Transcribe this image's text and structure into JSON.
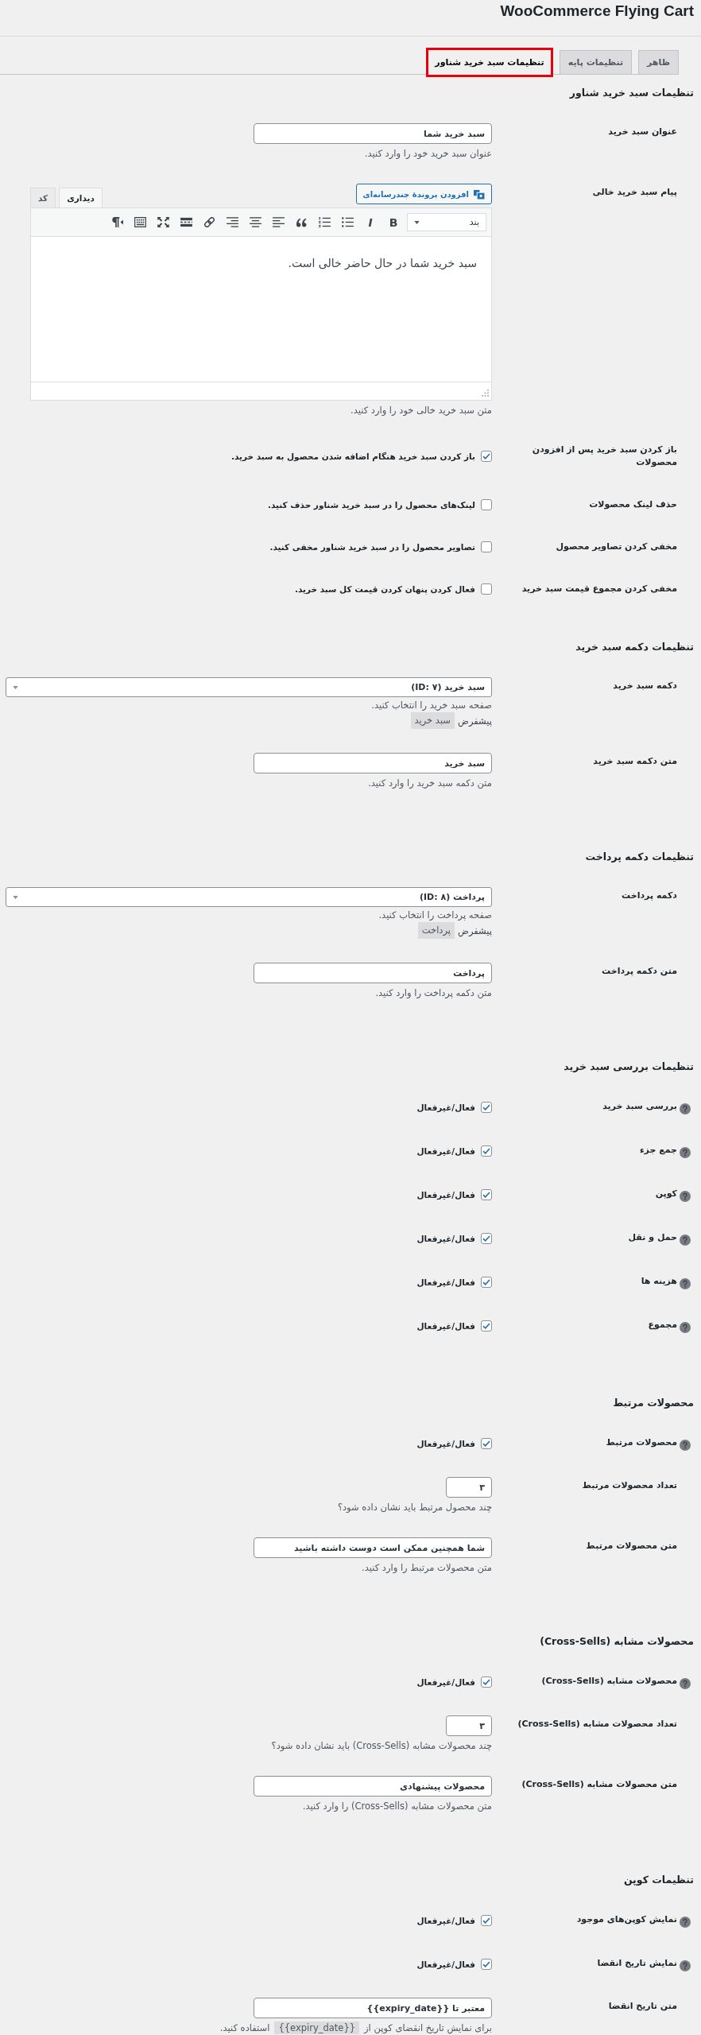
{
  "page_title": "WooCommerce Flying Cart",
  "tabs": [
    {
      "label": "ظاهر",
      "selected": false,
      "highlighted": false
    },
    {
      "label": "تنظیمات پایه",
      "selected": false,
      "highlighted": false
    },
    {
      "label": "تنظیمات سبد خرید شناور",
      "selected": true,
      "highlighted": true
    }
  ],
  "sections": [
    {
      "title": "تنظیمات سبد خرید شناور",
      "rows": [
        {
          "kind": "text",
          "label": "عنوان سبد خرید",
          "help": false,
          "value": "سبد خرید شما",
          "description": "عنوان سبد خرید خود را وارد کنید."
        },
        {
          "kind": "editor",
          "label": "پیام سبد خرید خالی",
          "help": false,
          "media_button": "افزودن پروندهٔ چندرسانه‌ای",
          "editor_tabs": [
            {
              "label": "دیداری",
              "selected": true
            },
            {
              "label": "کد",
              "selected": false
            }
          ],
          "toolbar": [
            {
              "kind": "format",
              "value": "بند"
            },
            {
              "kind": "bold",
              "text": "B"
            },
            {
              "kind": "italic",
              "text": "I"
            },
            {
              "kind": "bullet-list"
            },
            {
              "kind": "numbered-list"
            },
            {
              "kind": "blockquote"
            },
            {
              "kind": "align-left"
            },
            {
              "kind": "align-center"
            },
            {
              "kind": "align-right"
            },
            {
              "kind": "link"
            },
            {
              "kind": "read-more"
            },
            {
              "kind": "fullscreen"
            },
            {
              "kind": "toolbar-toggle"
            },
            {
              "kind": "rtl"
            }
          ],
          "content": "سبد خرید شما در حال حاضر خالی است.",
          "description": "متن سبد خرید خالی خود را وارد کنید."
        },
        {
          "kind": "checkbox",
          "label": "باز کردن سبد خرید پس از افزودن محصولات",
          "help": false,
          "checked": true,
          "option": "باز کردن سبد خرید هنگام اضافه شدن محصول به سبد خرید."
        },
        {
          "kind": "checkbox",
          "label": "حذف لینک محصولات",
          "help": false,
          "checked": false,
          "option": "لینک‌های محصول را در سبد خرید شناور حذف کنید."
        },
        {
          "kind": "checkbox",
          "label": "مخفی کردن تصاویر محصول",
          "help": false,
          "checked": false,
          "option": "تصاویر محصول را در سبد خرید شناور مخفی کنید."
        },
        {
          "kind": "checkbox",
          "label": "مخفی کردن مجموع قیمت سبد خرید",
          "help": false,
          "checked": false,
          "option": "فعال کردن پنهان کردن قیمت کل سبد خرید."
        }
      ]
    },
    {
      "title": "تنظیمات دکمه سبد خرید",
      "rows": [
        {
          "kind": "select",
          "label": "دکمه سبد خرید",
          "help": false,
          "value": "سبد خرید (ID: ۷)",
          "description": "صفحه سبد خرید را انتخاب کنید.",
          "default_label": "پیشفرض",
          "default_value": "سبد خرید"
        },
        {
          "kind": "text",
          "label": "متن دکمه سبد خرید",
          "help": false,
          "value": "سبد خرید",
          "description": "متن دکمه سبد خرید را وارد کنید."
        }
      ]
    },
    {
      "title": "تنظیمات دکمه پرداخت",
      "rows": [
        {
          "kind": "select",
          "label": "دکمه پرداخت",
          "help": false,
          "value": "پرداخت (ID: ۸)",
          "description": "صفحه پرداخت را انتخاب کنید.",
          "default_label": "پیشفرض",
          "default_value": "پرداخت"
        },
        {
          "kind": "text",
          "label": "متن دکمه پرداخت",
          "help": false,
          "value": "پرداخت",
          "description": "متن دکمه پرداخت را وارد کنید."
        }
      ]
    },
    {
      "title": "تنظیمات بررسی سبد خرید",
      "rows": [
        {
          "kind": "checkbox",
          "label": "بررسی سبد خرید",
          "help": true,
          "checked": true,
          "option": "فعال/غیرفعال"
        },
        {
          "kind": "checkbox",
          "label": "جمع جزء",
          "help": true,
          "checked": true,
          "option": "فعال/غیرفعال"
        },
        {
          "kind": "checkbox",
          "label": "کوپن",
          "help": true,
          "checked": true,
          "option": "فعال/غیرفعال"
        },
        {
          "kind": "checkbox",
          "label": "حمل و نقل",
          "help": true,
          "checked": true,
          "option": "فعال/غیرفعال"
        },
        {
          "kind": "checkbox",
          "label": "هزینه ها",
          "help": true,
          "checked": true,
          "option": "فعال/غیرفعال"
        },
        {
          "kind": "checkbox",
          "label": "مجموع",
          "help": true,
          "checked": true,
          "option": "فعال/غیرفعال"
        }
      ]
    },
    {
      "title": "محصولات مرتبط",
      "rows": [
        {
          "kind": "checkbox",
          "label": "محصولات مرتبط",
          "help": true,
          "checked": true,
          "option": "فعال/غیرفعال"
        },
        {
          "kind": "number",
          "label": "تعداد محصولات مرتبط",
          "help": false,
          "value": "۳",
          "description": "چند محصول مرتبط باید نشان داده شود؟"
        },
        {
          "kind": "text",
          "label": "متن محصولات مرتبط",
          "help": false,
          "value": "شما همچنین ممکن است دوست داشته باشید",
          "description": "متن محصولات مرتبط را وارد کنید."
        }
      ]
    },
    {
      "title": "محصولات مشابه (Cross-Sells)",
      "rows": [
        {
          "kind": "checkbox",
          "label": "محصولات مشابه (Cross-Sells)",
          "help": true,
          "checked": true,
          "option": "فعال/غیرفعال"
        },
        {
          "kind": "number",
          "label": "تعداد محصولات مشابه (Cross-Sells)",
          "help": false,
          "value": "۳",
          "description": "چند محصولات مشابه (Cross-Sells) باید نشان داده شود؟"
        },
        {
          "kind": "text",
          "label": "متن محصولات مشابه (Cross-Sells)",
          "help": false,
          "value": "محصولات پیشنهادی",
          "description": "متن محصولات مشابه (Cross-Sells) را وارد کنید."
        }
      ]
    },
    {
      "title": "تنظیمات کوپن",
      "rows": [
        {
          "kind": "checkbox",
          "label": "نمایش کوپن‌های موجود",
          "help": true,
          "checked": true,
          "option": "فعال/غیرفعال"
        },
        {
          "kind": "checkbox",
          "label": "نمایش تاریخ انقضا",
          "help": true,
          "checked": true,
          "option": "فعال/غیرفعال"
        },
        {
          "kind": "text",
          "label": "متن تاریخ انقضا",
          "help": false,
          "value": "معتبر تا {{expiry_date}}",
          "description": "برای نمایش تاریخ انقضای کوپن از",
          "description_code": "{{expiry_date}}",
          "description_end": "استفاده کنید."
        }
      ]
    }
  ]
}
